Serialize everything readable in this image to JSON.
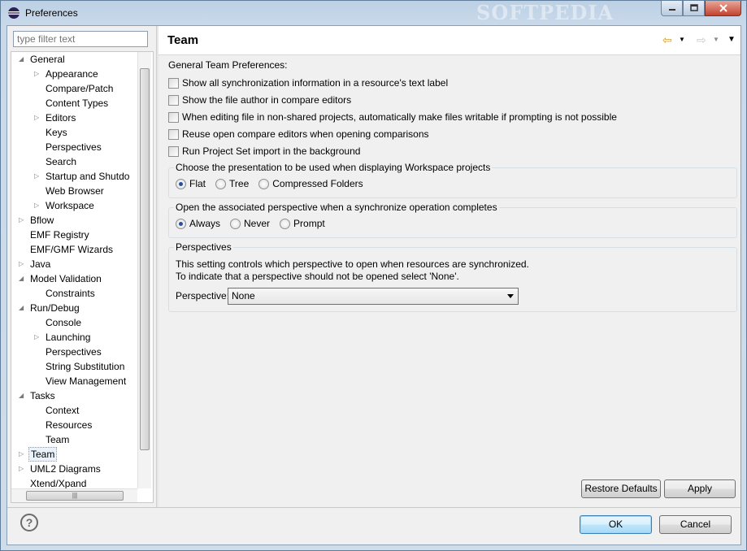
{
  "window": {
    "title": "Preferences",
    "watermark": "SOFTPEDIA"
  },
  "filter": {
    "placeholder": "type filter text"
  },
  "tree": {
    "items": [
      {
        "label": "General",
        "expanded": true,
        "level": 0
      },
      {
        "label": "Appearance",
        "expandable": true,
        "level": 1
      },
      {
        "label": "Compare/Patch",
        "level": 1
      },
      {
        "label": "Content Types",
        "level": 1
      },
      {
        "label": "Editors",
        "expandable": true,
        "level": 1
      },
      {
        "label": "Keys",
        "level": 1
      },
      {
        "label": "Perspectives",
        "level": 1
      },
      {
        "label": "Search",
        "level": 1
      },
      {
        "label": "Startup and Shutdo",
        "expandable": true,
        "level": 1
      },
      {
        "label": "Web Browser",
        "level": 1
      },
      {
        "label": "Workspace",
        "expandable": true,
        "level": 1
      },
      {
        "label": "Bflow",
        "expandable": true,
        "level": 0
      },
      {
        "label": "EMF Registry",
        "level": 0
      },
      {
        "label": "EMF/GMF Wizards",
        "level": 0
      },
      {
        "label": "Java",
        "expandable": true,
        "level": 0
      },
      {
        "label": "Model Validation",
        "expanded": true,
        "level": 0
      },
      {
        "label": "Constraints",
        "level": 1
      },
      {
        "label": "Run/Debug",
        "expanded": true,
        "level": 0
      },
      {
        "label": "Console",
        "level": 1
      },
      {
        "label": "Launching",
        "expandable": true,
        "level": 1
      },
      {
        "label": "Perspectives",
        "level": 1
      },
      {
        "label": "String Substitution",
        "level": 1
      },
      {
        "label": "View Management",
        "level": 1
      },
      {
        "label": "Tasks",
        "expanded": true,
        "level": 0
      },
      {
        "label": "Context",
        "level": 1
      },
      {
        "label": "Resources",
        "level": 1
      },
      {
        "label": "Team",
        "level": 1
      },
      {
        "label": "Team",
        "expandable": true,
        "level": 0,
        "selected": true
      },
      {
        "label": "UML2 Diagrams",
        "expandable": true,
        "level": 0
      },
      {
        "label": "Xtend/Xpand",
        "level": 0
      }
    ]
  },
  "page": {
    "title": "Team",
    "general_label": "General Team Preferences:",
    "checkboxes": [
      {
        "label": "Show all synchronization information in a resource's text label",
        "checked": false
      },
      {
        "label": "Show the file author in compare editors",
        "checked": false
      },
      {
        "label": "When editing file in non-shared projects, automatically make files writable if prompting is not possible",
        "checked": false
      },
      {
        "label": "Reuse open compare editors when opening comparisons",
        "checked": false
      },
      {
        "label": "Run Project Set import in the background",
        "checked": false
      }
    ],
    "presentation": {
      "title": "Choose the presentation to be used when displaying Workspace projects",
      "options": [
        "Flat",
        "Tree",
        "Compressed Folders"
      ],
      "selected": "Flat"
    },
    "perspective_open": {
      "title": "Open the associated perspective when a synchronize operation completes",
      "options": [
        "Always",
        "Never",
        "Prompt"
      ],
      "selected": "Always"
    },
    "perspectives": {
      "title": "Perspectives",
      "desc1": "This setting controls which perspective to open when resources are synchronized.",
      "desc2": "To indicate that a perspective should not be opened select 'None'.",
      "field_label": "Perspective:",
      "value": "None"
    },
    "buttons": {
      "restore_defaults": "Restore Defaults",
      "apply": "Apply"
    }
  },
  "footer": {
    "help": "?",
    "ok": "OK",
    "cancel": "Cancel"
  },
  "colors": {
    "accent": "#3c7fb1",
    "selection": "#eaf2fb"
  }
}
